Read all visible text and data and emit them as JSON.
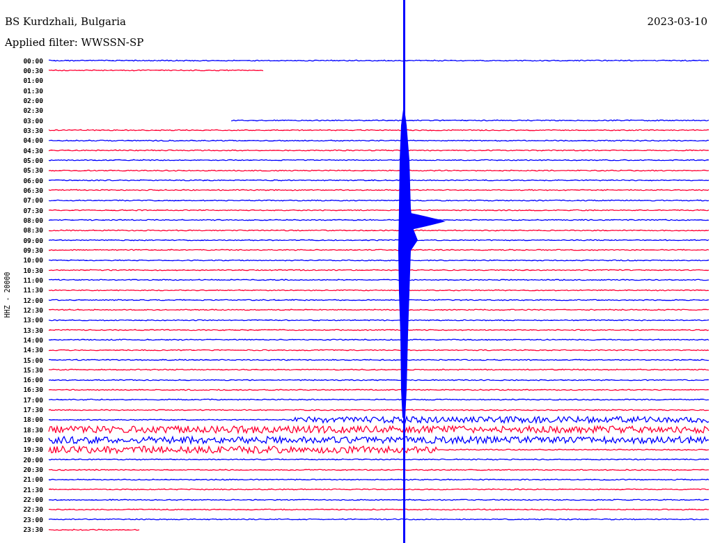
{
  "header": {
    "station": "BS Kurdzhali, Bulgaria",
    "date": "2023-03-10",
    "filter": "Applied filter: WWSSN-SP"
  },
  "channel_label": "HHZ - 20000",
  "rows": [
    {
      "time": "00:00",
      "color": "#0000ff",
      "kind": "full"
    },
    {
      "time": "00:30",
      "color": "#ff0033",
      "kind": "partial-end"
    },
    {
      "time": "01:00",
      "kind": "empty"
    },
    {
      "time": "01:30",
      "kind": "empty"
    },
    {
      "time": "02:00",
      "kind": "empty"
    },
    {
      "time": "02:30",
      "kind": "empty"
    },
    {
      "time": "03:00",
      "color": "#0000ff",
      "kind": "partial-start"
    },
    {
      "time": "03:30",
      "color": "#ff0033",
      "kind": "full"
    },
    {
      "time": "04:00",
      "color": "#0000ff",
      "kind": "full"
    },
    {
      "time": "04:30",
      "color": "#ff0033",
      "kind": "full"
    },
    {
      "time": "05:00",
      "color": "#0000ff",
      "kind": "full"
    },
    {
      "time": "05:30",
      "color": "#ff0033",
      "kind": "full"
    },
    {
      "time": "06:00",
      "color": "#0000ff",
      "kind": "full"
    },
    {
      "time": "06:30",
      "color": "#ff0033",
      "kind": "full"
    },
    {
      "time": "07:00",
      "color": "#0000ff",
      "kind": "full"
    },
    {
      "time": "07:30",
      "color": "#ff0033",
      "kind": "full"
    },
    {
      "time": "08:00",
      "color": "#0000ff",
      "kind": "full"
    },
    {
      "time": "08:30",
      "color": "#ff0033",
      "kind": "full"
    },
    {
      "time": "09:00",
      "color": "#0000ff",
      "kind": "full"
    },
    {
      "time": "09:30",
      "color": "#ff0033",
      "kind": "full"
    },
    {
      "time": "10:00",
      "color": "#0000ff",
      "kind": "full"
    },
    {
      "time": "10:30",
      "color": "#ff0033",
      "kind": "full"
    },
    {
      "time": "11:00",
      "color": "#0000ff",
      "kind": "full"
    },
    {
      "time": "11:30",
      "color": "#ff0033",
      "kind": "full"
    },
    {
      "time": "12:00",
      "color": "#0000ff",
      "kind": "full"
    },
    {
      "time": "12:30",
      "color": "#ff0033",
      "kind": "full"
    },
    {
      "time": "13:00",
      "color": "#0000ff",
      "kind": "full"
    },
    {
      "time": "13:30",
      "color": "#ff0033",
      "kind": "full"
    },
    {
      "time": "14:00",
      "color": "#0000ff",
      "kind": "full"
    },
    {
      "time": "14:30",
      "color": "#ff0033",
      "kind": "full"
    },
    {
      "time": "15:00",
      "color": "#0000ff",
      "kind": "full"
    },
    {
      "time": "15:30",
      "color": "#ff0033",
      "kind": "full"
    },
    {
      "time": "16:00",
      "color": "#0000ff",
      "kind": "full"
    },
    {
      "time": "16:30",
      "color": "#ff0033",
      "kind": "full"
    },
    {
      "time": "17:00",
      "color": "#0000ff",
      "kind": "full"
    },
    {
      "time": "17:30",
      "color": "#ff0033",
      "kind": "full"
    },
    {
      "time": "18:00",
      "color": "#0000ff",
      "kind": "noisy-start"
    },
    {
      "time": "18:30",
      "color": "#ff0033",
      "kind": "noisy"
    },
    {
      "time": "19:00",
      "color": "#0000ff",
      "kind": "noisy"
    },
    {
      "time": "19:30",
      "color": "#ff0033",
      "kind": "noisy-end"
    },
    {
      "time": "20:00",
      "color": "#0000ff",
      "kind": "full"
    },
    {
      "time": "20:30",
      "color": "#ff0033",
      "kind": "full"
    },
    {
      "time": "21:00",
      "color": "#0000ff",
      "kind": "full"
    },
    {
      "time": "21:30",
      "color": "#ff0033",
      "kind": "full"
    },
    {
      "time": "22:00",
      "color": "#0000ff",
      "kind": "full"
    },
    {
      "time": "22:30",
      "color": "#ff0033",
      "kind": "full"
    },
    {
      "time": "23:00",
      "color": "#0000ff",
      "kind": "full"
    },
    {
      "time": "23:30",
      "color": "#ff0033",
      "kind": "partial-end"
    }
  ]
}
